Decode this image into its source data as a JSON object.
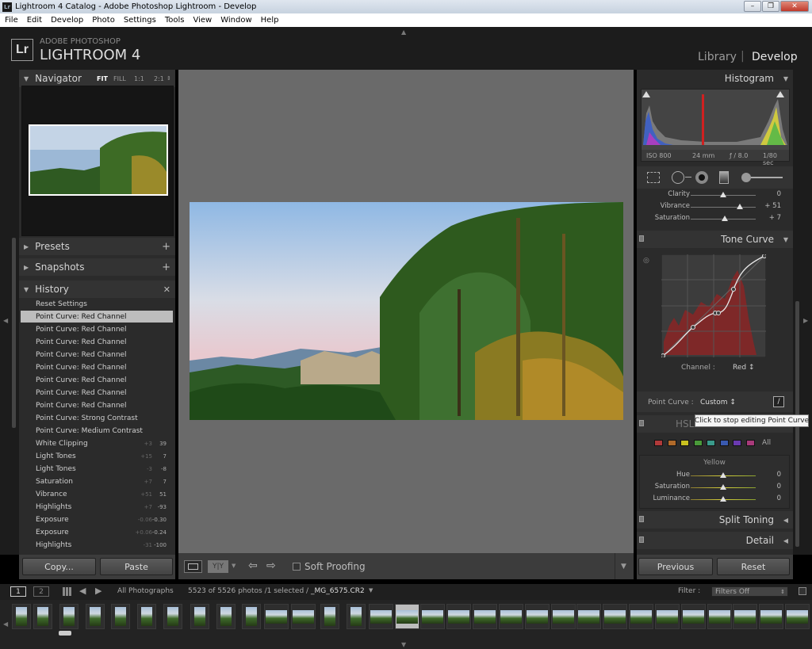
{
  "window": {
    "title": "Lightroom 4 Catalog - Adobe Photoshop Lightroom - Develop",
    "app_icon": "Lr"
  },
  "menu": [
    "File",
    "Edit",
    "Develop",
    "Photo",
    "Settings",
    "Tools",
    "View",
    "Window",
    "Help"
  ],
  "identity": {
    "brand_top": "ADOBE PHOTOSHOP",
    "brand_name": "LIGHTROOM 4",
    "logo": "Lr"
  },
  "modules": {
    "library": "Library",
    "separator": "|",
    "develop": "Develop"
  },
  "navigator": {
    "title": "Navigator",
    "zoom": [
      "FIT",
      "FILL",
      "1:1",
      "2:1"
    ]
  },
  "left_panels": {
    "presets": "Presets",
    "snapshots": "Snapshots",
    "history": "History"
  },
  "history": [
    {
      "label": "Reset Settings",
      "v1": "",
      "v2": ""
    },
    {
      "label": "Point Curve: Red Channel",
      "v1": "",
      "v2": "",
      "selected": true
    },
    {
      "label": "Point Curve: Red Channel",
      "v1": "",
      "v2": ""
    },
    {
      "label": "Point Curve: Red Channel",
      "v1": "",
      "v2": ""
    },
    {
      "label": "Point Curve: Red Channel",
      "v1": "",
      "v2": ""
    },
    {
      "label": "Point Curve: Red Channel",
      "v1": "",
      "v2": ""
    },
    {
      "label": "Point Curve: Red Channel",
      "v1": "",
      "v2": ""
    },
    {
      "label": "Point Curve: Red Channel",
      "v1": "",
      "v2": ""
    },
    {
      "label": "Point Curve: Red Channel",
      "v1": "",
      "v2": ""
    },
    {
      "label": "Point Curve: Strong Contrast",
      "v1": "",
      "v2": ""
    },
    {
      "label": "Point Curve: Medium Contrast",
      "v1": "",
      "v2": ""
    },
    {
      "label": "White Clipping",
      "v1": "+3",
      "v2": "39"
    },
    {
      "label": "Light Tones",
      "v1": "+15",
      "v2": "7"
    },
    {
      "label": "Light Tones",
      "v1": "-3",
      "v2": "-8"
    },
    {
      "label": "Saturation",
      "v1": "+7",
      "v2": "7"
    },
    {
      "label": "Vibrance",
      "v1": "+51",
      "v2": "51"
    },
    {
      "label": "Highlights",
      "v1": "+7",
      "v2": "-93"
    },
    {
      "label": "Exposure",
      "v1": "-0.06",
      "v2": "-0.30"
    },
    {
      "label": "Exposure",
      "v1": "+0.06",
      "v2": "-0.24"
    },
    {
      "label": "Highlights",
      "v1": "-31",
      "v2": "-100"
    }
  ],
  "left_buttons": {
    "copy": "Copy...",
    "paste": "Paste"
  },
  "toolbar": {
    "soft_proofing": "Soft Proofing",
    "compare": "Y|Y"
  },
  "right_panels": {
    "histogram": "Histogram",
    "tone_curve": "Tone Curve",
    "hsl": "HSL",
    "split_toning": "Split Toning",
    "detail": "Detail"
  },
  "histogram_info": {
    "iso": "ISO 800",
    "focal": "24 mm",
    "aperture": "ƒ / 8.0",
    "shutter": "1/80 sec"
  },
  "presence": [
    {
      "label": "Clarity",
      "value": "0",
      "pos": 0.5
    },
    {
      "label": "Vibrance",
      "value": "+ 51",
      "pos": 0.75
    },
    {
      "label": "Saturation",
      "value": "+ 7",
      "pos": 0.53
    }
  ],
  "tone_curve": {
    "channel_label": "Channel :",
    "channel_value": "Red ↕",
    "point_curve_label": "Point Curve :",
    "point_curve_value": "Custom ↕"
  },
  "tooltip": "Click to stop editing Point Curve",
  "hsl": {
    "all": "All",
    "swatches": [
      "#b03a3a",
      "#b06a2a",
      "#c8c020",
      "#4a9a3a",
      "#3a9a8a",
      "#3a5ab0",
      "#6a3ab0",
      "#a83a7a"
    ],
    "color_title": "Yellow",
    "sliders": [
      {
        "label": "Hue",
        "value": "0",
        "pos": 0.5
      },
      {
        "label": "Saturation",
        "value": "0",
        "pos": 0.5
      },
      {
        "label": "Luminance",
        "value": "0",
        "pos": 0.5
      }
    ]
  },
  "right_buttons": {
    "previous": "Previous",
    "reset": "Reset"
  },
  "filmbar": {
    "page1": "1",
    "page2": "2",
    "source": "All Photographs",
    "count": "5523 of 5526 photos /1 selected /",
    "filename": "_MG_6575.CR2",
    "filter_label": "Filter :",
    "filter_value": "Filters Off"
  },
  "colors": {
    "panel": "#2b2b2b",
    "center": "#6a6a6a",
    "curve_red": "#8a2525",
    "hist_red": "#d02020"
  }
}
